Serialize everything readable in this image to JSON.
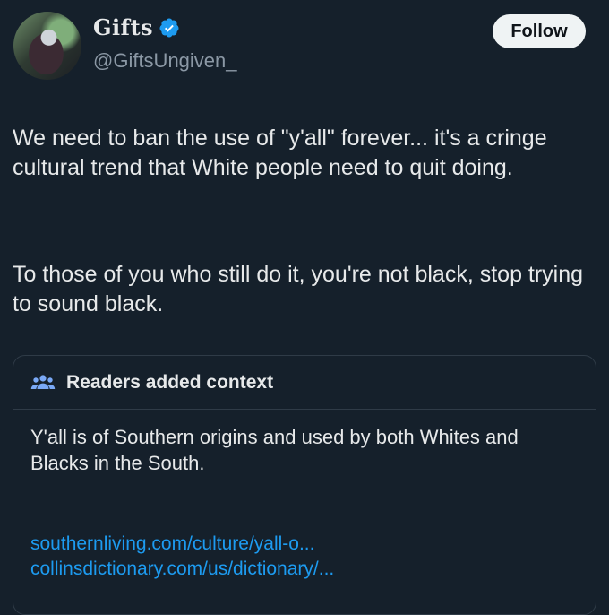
{
  "tweet": {
    "display_name": "Gifts",
    "handle": "@GiftsUngiven_",
    "follow_label": "Follow",
    "paragraph1": "We need to ban the use of \"y'all\" forever... it's a cringe cultural trend that White people need to quit doing.",
    "paragraph2": "To those of you who still do it, you're not black, stop trying to sound black."
  },
  "context_note": {
    "title": "Readers added context",
    "text": "Y'all is of Southern origins and used by both Whites and Blacks in the South.",
    "links": [
      "southernliving.com/culture/yall-o...",
      "collinsdictionary.com/us/dictionary/..."
    ]
  },
  "colors": {
    "background": "#15202b",
    "text": "#e7e9ea",
    "secondary_text": "#8b98a5",
    "link": "#1d9bf0",
    "verified": "#1d9bf0",
    "follow_bg": "#eff3f4"
  },
  "icons": {
    "verified": "verified-badge-icon",
    "context": "people-icon"
  }
}
